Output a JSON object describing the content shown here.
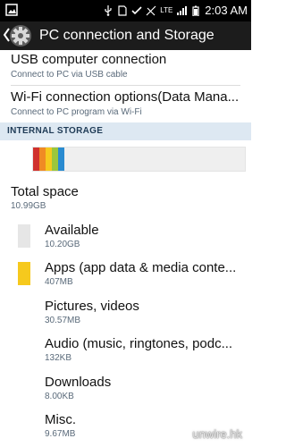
{
  "status_bar": {
    "time": "2:03 AM",
    "network": "LTE"
  },
  "action_bar": {
    "title": "PC connection and Storage",
    "back_icon": "chevron-left-icon",
    "app_icon": "gear-icon"
  },
  "connection": {
    "usb": {
      "label": "USB computer connection",
      "summary": "Connect to PC via USB cable"
    },
    "wifi": {
      "label": "Wi-Fi connection options(Data Mana...",
      "summary": "Connect to PC program via Wi-Fi"
    }
  },
  "storage": {
    "section_title": "INTERNAL STORAGE",
    "total": {
      "label": "Total space",
      "value": "10.99GB"
    },
    "usage_colors": [
      "#d0312d",
      "#f08a24",
      "#f6c91d",
      "#9bc73c",
      "#2a8bd0"
    ],
    "items": [
      {
        "label": "Available",
        "size": "10.20GB",
        "color": "#e6e6e6"
      },
      {
        "label": "Apps (app data & media conte...",
        "size": "407MB",
        "color": "#d0312d"
      },
      {
        "label": "Pictures, videos",
        "size": "30.57MB",
        "color": "#f08a24"
      },
      {
        "label": "Audio (music, ringtones, podc...",
        "size": "132KB",
        "color": "#f6c91d"
      },
      {
        "label": "Downloads",
        "size": "8.00KB",
        "color": "#9bc73c"
      },
      {
        "label": "Misc.",
        "size": "9.67MB",
        "color": "#2a8bd0"
      }
    ]
  },
  "watermark": "unwire.hk"
}
